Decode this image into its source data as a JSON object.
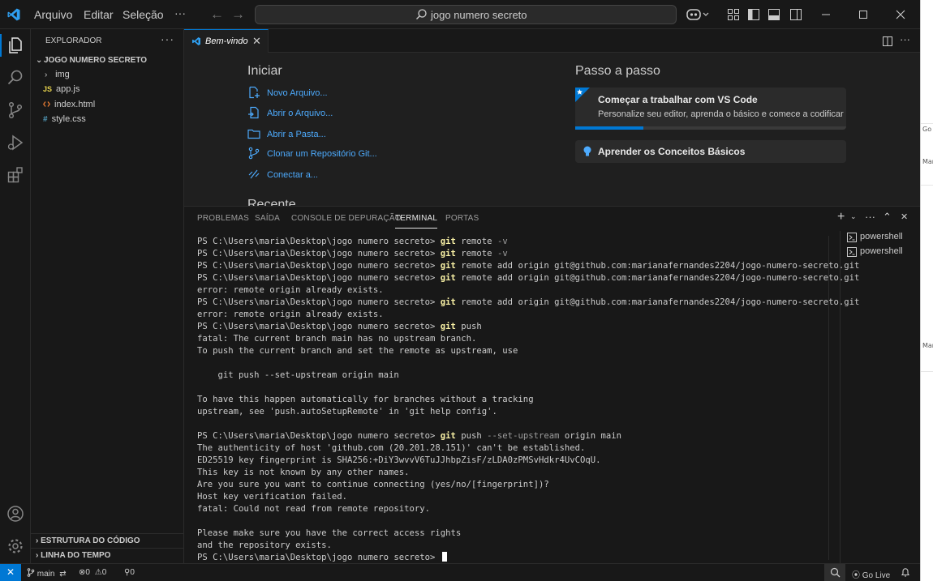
{
  "titlebar": {
    "menus": [
      "Arquivo",
      "Editar",
      "Seleção",
      "···"
    ],
    "search_text": "jogo numero secreto",
    "nav_back": "←",
    "nav_forward": "→"
  },
  "sidebar": {
    "title": "EXPLORADOR",
    "more": "···",
    "folder": "JOGO NUMERO SECRETO",
    "items": [
      {
        "label": "img",
        "kind": "folder"
      },
      {
        "label": "app.js",
        "kind": "js",
        "icon_text": "JS"
      },
      {
        "label": "index.html",
        "kind": "html"
      },
      {
        "label": "style.css",
        "kind": "css",
        "icon_text": "#"
      }
    ],
    "sections": [
      "ESTRUTURA DO CÓDIGO",
      "LINHA DO TEMPO"
    ]
  },
  "editor": {
    "tab_label": "Bem-vindo",
    "tab_close": "✕",
    "start_heading": "Iniciar",
    "start_links": [
      "Novo Arquivo...",
      "Abrir o Arquivo...",
      "Abrir a Pasta...",
      "Clonar um Repositório Git...",
      "Conectar a..."
    ],
    "recent_heading": "Recente",
    "walkthrough_heading": "Passo a passo",
    "walkthroughs": [
      {
        "title": "Começar a trabalhar com VS Code",
        "description": "Personalize seu editor, aprenda o básico e comece a codificar",
        "progress": 0.25
      },
      {
        "title": "Aprender os Conceitos Básicos"
      }
    ]
  },
  "panel": {
    "tabs": [
      "PROBLEMAS",
      "SAÍDA",
      "CONSOLE DE DEPURAÇÃO",
      "TERMINAL",
      "PORTAS"
    ],
    "active_tab": "TERMINAL",
    "shells": [
      "powershell",
      "powershell"
    ],
    "terminal_lines": [
      {
        "prompt": "PS C:\\Users\\maria\\Desktop\\jogo numero secreto> ",
        "cmd": "git",
        "rest": " remote",
        "arg": " -v"
      },
      {
        "prompt": "PS C:\\Users\\maria\\Desktop\\jogo numero secreto> ",
        "cmd": "git",
        "rest": " remote",
        "arg": " -v"
      },
      {
        "prompt": "PS C:\\Users\\maria\\Desktop\\jogo numero secreto> ",
        "cmd": "git",
        "rest": " remote add origin git@github.com:marianafernandes2204/jogo-numero-secreto.git"
      },
      {
        "prompt": "PS C:\\Users\\maria\\Desktop\\jogo numero secreto> ",
        "cmd": "git",
        "rest": " remote add origin git@github.com:marianafernandes2204/jogo-numero-secreto.git"
      },
      {
        "text": "error: remote origin already exists."
      },
      {
        "prompt": "PS C:\\Users\\maria\\Desktop\\jogo numero secreto> ",
        "cmd": "git",
        "rest": " remote add origin git@github.com:marianafernandes2204/jogo-numero-secreto.git"
      },
      {
        "text": "error: remote origin already exists."
      },
      {
        "prompt": "PS C:\\Users\\maria\\Desktop\\jogo numero secreto> ",
        "cmd": "git",
        "rest": " push"
      },
      {
        "text": "fatal: The current branch main has no upstream branch."
      },
      {
        "text": "To push the current branch and set the remote as upstream, use"
      },
      {
        "text": ""
      },
      {
        "text": "    git push --set-upstream origin main"
      },
      {
        "text": ""
      },
      {
        "text": "To have this happen automatically for branches without a tracking"
      },
      {
        "text": "upstream, see 'push.autoSetupRemote' in 'git help config'."
      },
      {
        "text": ""
      },
      {
        "prompt": "PS C:\\Users\\maria\\Desktop\\jogo numero secreto> ",
        "cmd": "git",
        "rest": " push",
        "arg": " --set-upstream",
        "tail": " origin main"
      },
      {
        "text": "The authenticity of host 'github.com (20.201.28.151)' can't be established."
      },
      {
        "text": "ED25519 key fingerprint is SHA256:+DiY3wvvV6TuJJhbpZisF/zLDA0zPMSvHdkr4UvCOqU."
      },
      {
        "text": "This key is not known by any other names."
      },
      {
        "text": "Are you sure you want to continue connecting (yes/no/[fingerprint])?"
      },
      {
        "text": "Host key verification failed."
      },
      {
        "text": "fatal: Could not read from remote repository."
      },
      {
        "text": ""
      },
      {
        "text": "Please make sure you have the correct access rights"
      },
      {
        "text": "and the repository exists."
      },
      {
        "prompt": "PS C:\\Users\\maria\\Desktop\\jogo numero secreto> ",
        "cursor": true
      }
    ]
  },
  "statusbar": {
    "remote": "✕",
    "branch": "main",
    "errors": "0",
    "warnings": "0",
    "ports": "0",
    "golive": "Go Live"
  },
  "background_window": {
    "texts": [
      "Go",
      "Mar",
      "Mar"
    ]
  },
  "colors": {
    "accent": "#0078d4",
    "link": "#4daafc",
    "git_keyword": "#f9f1a5",
    "background": "#1f1f1f"
  }
}
